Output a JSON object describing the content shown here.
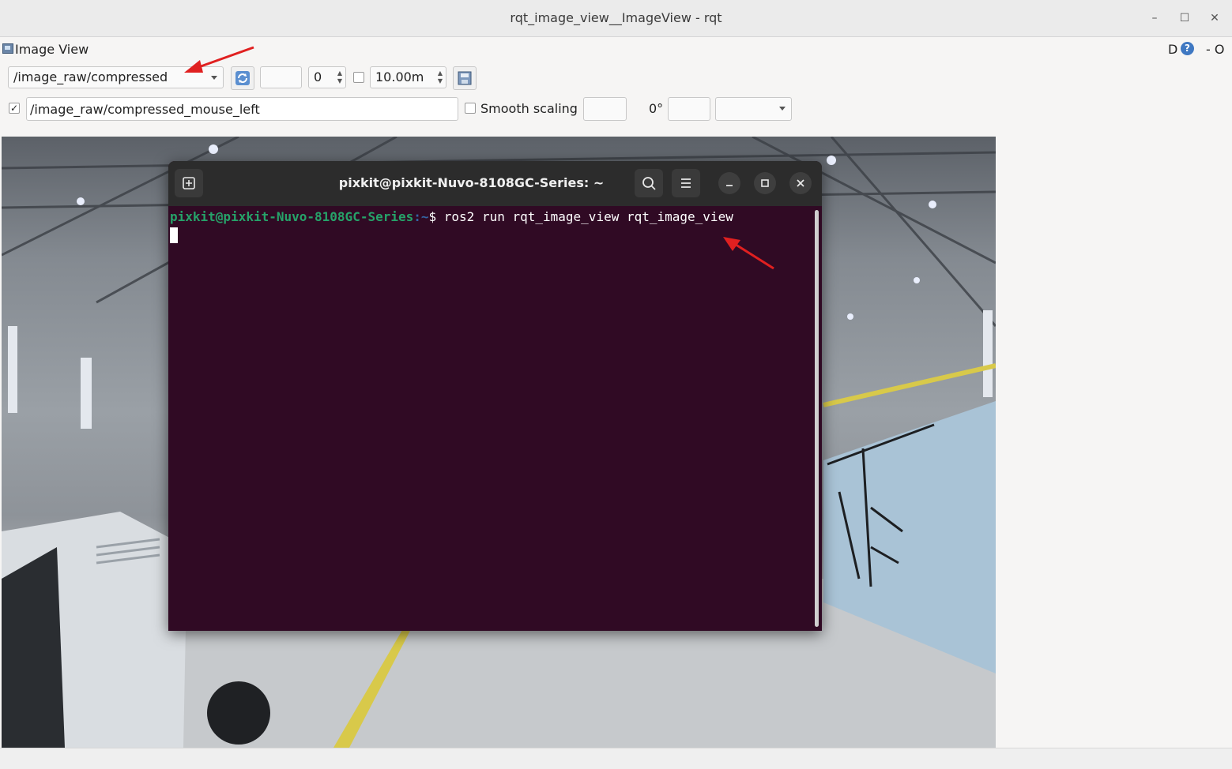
{
  "window": {
    "title": "rqt_image_view__ImageView - rqt",
    "controls": [
      "–",
      "☐",
      "✕"
    ]
  },
  "plugin": {
    "title": "Image View",
    "right_text_d": "D",
    "right_text_min": "- O",
    "help_glyph": "?"
  },
  "toolbar": {
    "topic_select": "/image_raw/compressed",
    "spin_value": "0",
    "timeout_value": "10.00m",
    "mouse_publish_checked": "✓",
    "mouse_topic": "/image_raw/compressed_mouse_left",
    "smooth_scaling_label": "Smooth scaling",
    "rotation_label": "0°"
  },
  "terminal": {
    "title": "pixkit@pixkit-Nuvo-8108GC-Series: ~",
    "prompt_user": "pixkit@pixkit-Nuvo-8108GC-Series",
    "prompt_path": ":~",
    "prompt_symbol": "$ ",
    "command": "ros2 run rqt_image_view rqt_image_view",
    "button_icons": [
      "new-tab-icon",
      "search-icon",
      "menu-icon",
      "minimize-icon",
      "maximize-icon",
      "close-icon"
    ]
  },
  "colors": {
    "terminal_bg": "#300a24",
    "prompt_green": "#26a269",
    "annotation_red": "#e02020"
  }
}
